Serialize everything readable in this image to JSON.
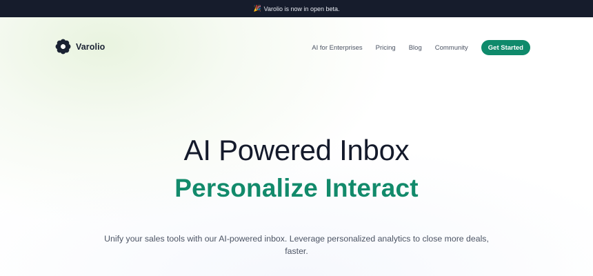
{
  "announcement": {
    "icon": "party-popper-icon",
    "text": "Varolio is now in open beta."
  },
  "header": {
    "brand": "Varolio",
    "nav": [
      {
        "label": "AI for Enterprises"
      },
      {
        "label": "Pricing"
      },
      {
        "label": "Blog"
      },
      {
        "label": "Community"
      }
    ],
    "cta_label": "Get Started"
  },
  "hero": {
    "title": "AI Powered Inbox",
    "subtitle": "Personalize Interact",
    "description": "Unify your sales tools with our AI-powered inbox. Leverage personalized analytics to close more deals, faster."
  },
  "colors": {
    "accent": "#0f8a6b",
    "announcement_bg": "#161c2c",
    "heading": "#141a2b"
  }
}
